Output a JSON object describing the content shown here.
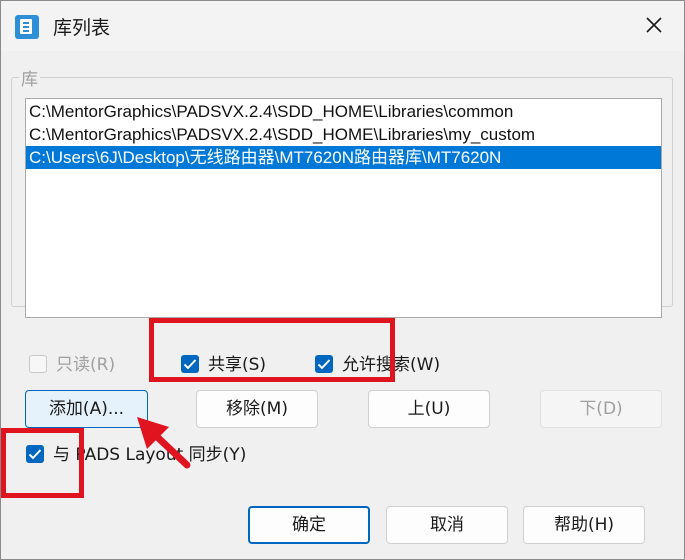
{
  "window": {
    "title": "库列表",
    "icon": "library-app-icon",
    "close_icon": "close-icon"
  },
  "library_group": {
    "label": "库",
    "items": [
      {
        "path": "C:\\MentorGraphics\\PADSVX.2.4\\SDD_HOME\\Libraries\\common",
        "selected": false
      },
      {
        "path": "C:\\MentorGraphics\\PADSVX.2.4\\SDD_HOME\\Libraries\\my_custom",
        "selected": false
      },
      {
        "path": "C:\\Users\\6J\\Desktop\\无线路由器\\MT7620N路由器库\\MT7620N",
        "selected": true
      }
    ]
  },
  "options": {
    "readonly": {
      "label": "只读(R)",
      "checked": false,
      "enabled": false
    },
    "shared": {
      "label": "共享(S)",
      "checked": true,
      "enabled": true
    },
    "allow_search": {
      "label": "允许搜索(W)",
      "checked": true,
      "enabled": true
    },
    "sync_layout": {
      "label": "与 PADS Layout 同步(Y)",
      "checked": true,
      "enabled": true
    }
  },
  "buttons": {
    "add": "添加(A)...",
    "remove": "移除(M)",
    "up": "上(U)",
    "down": "下(D)",
    "ok": "确定",
    "cancel": "取消",
    "help": "帮助(H)"
  },
  "colors": {
    "accent": "#0067c0",
    "selection": "#0078d7",
    "annotation": "#e0141e"
  }
}
